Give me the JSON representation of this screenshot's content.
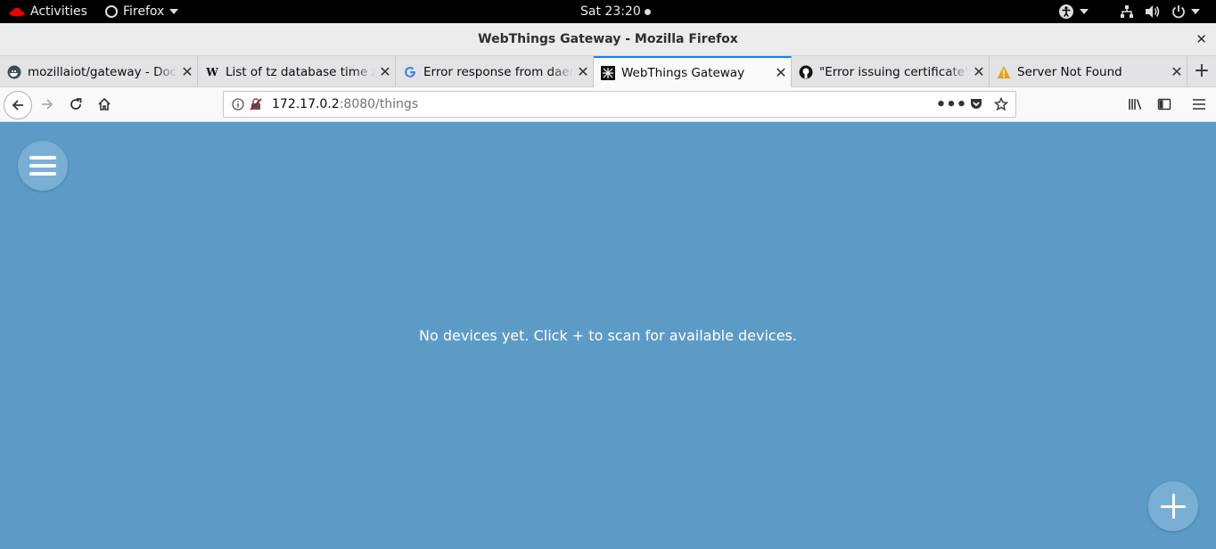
{
  "system_bar": {
    "activities": "Activities",
    "app_name": "Firefox",
    "clock": "Sat 23:20"
  },
  "window": {
    "title": "WebThings Gateway - Mozilla Firefox"
  },
  "tabs": [
    {
      "label": "mozillaiot/gateway - Docker Hub",
      "favicon": "docker-icon"
    },
    {
      "label": "List of tz database time zones",
      "favicon": "wikipedia-icon"
    },
    {
      "label": "Error response from daemon",
      "favicon": "google-icon"
    },
    {
      "label": "WebThings Gateway",
      "favicon": "webthings-icon",
      "active": true
    },
    {
      "label": "\"Error issuing certificate\"",
      "favicon": "github-icon"
    },
    {
      "label": "Server Not Found",
      "favicon": "warning-icon"
    }
  ],
  "address_bar": {
    "host": "172.17.0.2",
    "path": ":8080/things"
  },
  "page": {
    "empty_message": "No devices yet. Click + to scan for available devices.",
    "background_color": "#5d9bc7",
    "fab_color": "#7aafd5"
  }
}
